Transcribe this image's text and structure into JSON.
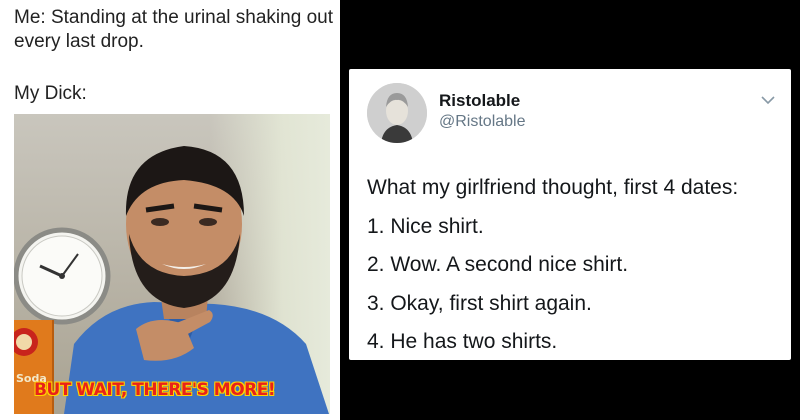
{
  "left_meme": {
    "caption_top": "Me: Standing at the urinal shaking out every last drop.",
    "caption_bottom": "My Dick:",
    "overlay_text": "BUT WAIT, THERE'S MORE!",
    "box_label": "Soda"
  },
  "tweet": {
    "display_name": "Ristolable",
    "handle": "@Ristolable",
    "lines": [
      "What my girlfriend thought, first 4 dates:",
      "1. Nice shirt.",
      "2. Wow. A second nice shirt.",
      "3. Okay, first shirt again.",
      "4. He has two shirts."
    ]
  },
  "colors": {
    "background": "#000000",
    "overlay_text": "#e8221a",
    "overlay_outline": "#ffd400",
    "handle": "#657786",
    "shirt": "#3f73c1"
  },
  "icons": {
    "menu_chevron": "chevron-down-icon"
  }
}
